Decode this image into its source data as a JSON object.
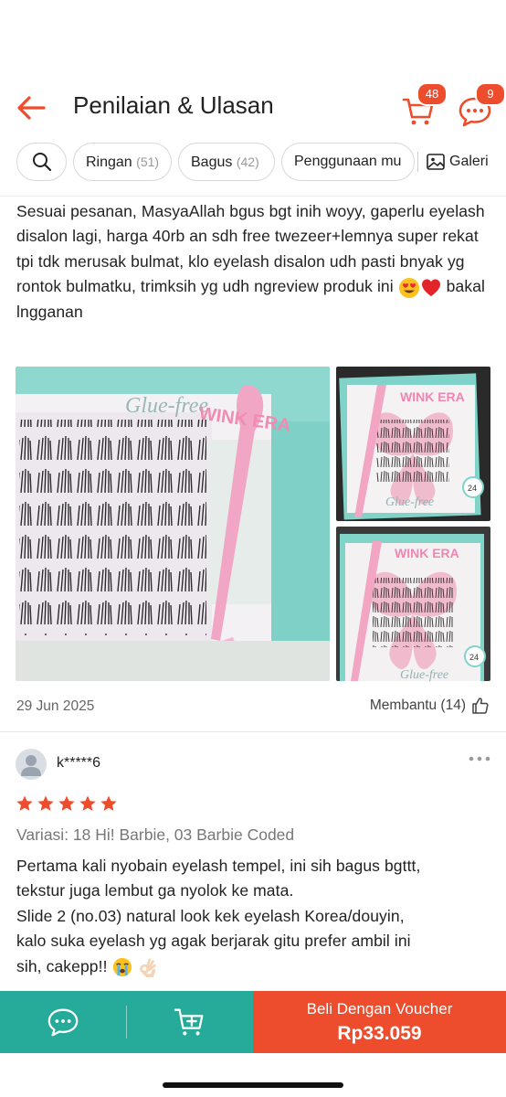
{
  "header": {
    "title": "Penilaian & Ulasan",
    "cart_badge": "48",
    "chat_badge": "9"
  },
  "filters": {
    "chips": [
      {
        "label": "Ringan",
        "count": "(51)"
      },
      {
        "label": "Bagus",
        "count": "(42)"
      },
      {
        "label": "Penggunaan mu",
        "count": ""
      }
    ],
    "gallery_label": "Galeri"
  },
  "review1": {
    "text": "Sesuai pesanan, MasyaAllah bgus bgt inih woyy, gaperlu eyelash disalon lagi, harga 40rb an sdh free twezeer+lemnya super rekat tpi tdk merusak bulmat, klo eyelash disalon udh pasti bnyak yg rontok bulmatku, trimksih yg udh ngreview produk ini",
    "text_end": " bakal lngganan",
    "photo_texts": [
      "Glue-free",
      "WINK ERA",
      "24"
    ],
    "date": "29 Jun 2025",
    "helpful_label": "Membantu (14)"
  },
  "review2": {
    "username": "k*****6",
    "rating": 5,
    "variation": "Variasi: 18 Hi! Barbie, 03 Barbie Coded",
    "text_lines": [
      "Pertama kali nyobain eyelash tempel, ini sih bagus bgttt,",
      "tekstur juga lembut ga nyolok ke mata.",
      "Slide 2 (no.03) natural look kek eyelash Korea/douyin,",
      "kalo suka eyelash yg agak berjarak gitu prefer ambil ini",
      "sih, cakepp!!"
    ]
  },
  "bottom_bar": {
    "buy_label": "Beli Dengan Voucher",
    "buy_price": "Rp33.059"
  },
  "colors": {
    "accent": "#ee4d2d",
    "teal": "#26aa99",
    "star": "#ee4d2d"
  }
}
